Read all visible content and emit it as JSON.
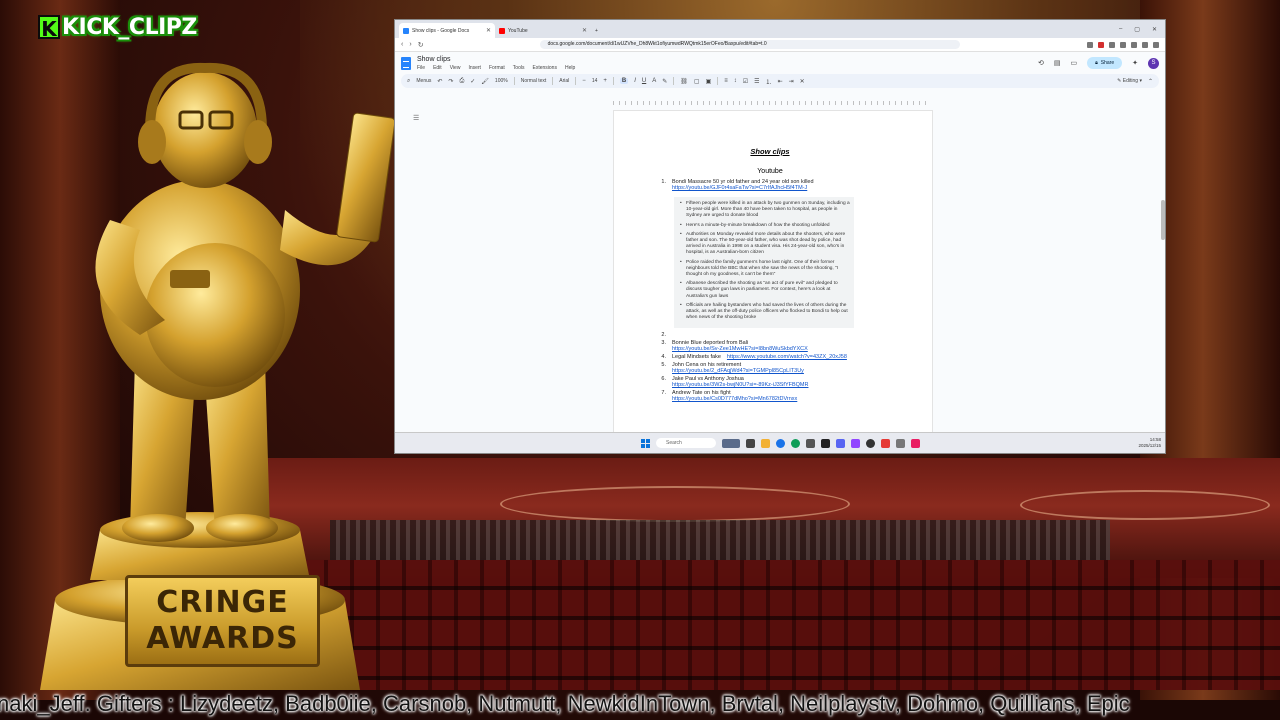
{
  "stream": {
    "channel_name": "KICK_CLIPZ",
    "channel_logo_letter": "K",
    "trophy_plaque": [
      "CRINGE",
      "AWARDS"
    ],
    "ticker": "naki_Jeff. Gifters : Lizydeetz, Badb0iie, Carsnob, Nutmutt, NewkidInTown, Brvtal, Neilplaystv, Dohmo, Quillians, Epic"
  },
  "browser": {
    "tabs": [
      {
        "label": "Show clips - Google Docs",
        "favicon_color": "#2684fc",
        "active": true
      },
      {
        "label": "YouTube",
        "favicon_color": "#ff0000",
        "active": false
      }
    ],
    "new_tab": "+",
    "address": "docs.google.com/document/d/1wUZVhe_Dh8Wkt1ofiyumwdRWQtmk15erOFeo/Baxpu/edit#tab=t.0"
  },
  "docs": {
    "title": "Show clips",
    "menu": [
      "File",
      "Edit",
      "View",
      "Insert",
      "Format",
      "Tools",
      "Extensions",
      "Help"
    ],
    "share_label": "Share",
    "avatar_letter": "S",
    "toolbar": {
      "menus": "Menus",
      "zoom": "100%",
      "style": "Normal text",
      "font": "Arial",
      "size": "14",
      "mode": "Editing"
    }
  },
  "document": {
    "heading": "Show clips",
    "subheading": "Youtube",
    "items": [
      {
        "num": "1.",
        "text": "Bondi Massacre 50 yr old father and 24 year old son killed",
        "link": "https://youtu.be/GJF0r4saFaTw?si=C7rIfAJhcH5f4TM-J"
      },
      {
        "num": "2.",
        "text": "",
        "link": ""
      },
      {
        "num": "3.",
        "text": "Bonnie Blue deported from Bali",
        "link": "https://youtu.be/Sv-Zee1MwHE?si=I8bn8WuSkbdYXCX"
      },
      {
        "num": "4.",
        "text": "Legal Mindsets fake",
        "link": "https://www.youtube.com/watch?v=43ZX_20xJ58"
      },
      {
        "num": "5.",
        "text": "John Cena on his retirement",
        "link": "https://youtu.be/2_dFAqjWd4?si=TGMPpl85CpLIT3Uy"
      },
      {
        "num": "6.",
        "text": "Jake Paul vs Anthony Joshua",
        "link": "https://youtu.be/3W2s-bwjN0U?si=-89Kz-iJ3SfYFBQMR"
      },
      {
        "num": "7.",
        "text": "Andrew Tate on his fight",
        "link": "https://youtu.be/Cs0D777dMho?si=Mn6782tDVrnxx"
      }
    ],
    "bullets": [
      "Fifteen people were killed in an attack by two gunmen on Sunday, including a 10-year-old girl. More than 40 have been taken to hospital, as people in Sydney are urged to donate blood",
      "Here's a minute-by-minute breakdown of how the shooting unfolded",
      "Authorities on Monday revealed more details about the shooters, who were father and son. The 50-year-old father, who was shot dead by police, had arrived in Australia in 1998 on a student visa. His 24-year-old son, who's in hospital, is an Australian-born citizen",
      "Police raided the family gunmen's home last night. One of their former neighbours told the BBC that when she saw the news of the shooting, \"I thought oh my goodness, it can't be them\"",
      "Albanese described the shooting as \"an act of pure evil\" and pledged to discuss tougher gun laws in parliament. For context, here's a look at Australia's gun laws",
      "Officials are hailing bystanders who had saved the lives of others during the attack, as well as the off-duty police officers who flocked to Bondi to help out when news of the shooting broke"
    ]
  },
  "taskbar": {
    "search_placeholder": "Search",
    "time": "14:58",
    "date": "2025/12/15"
  }
}
